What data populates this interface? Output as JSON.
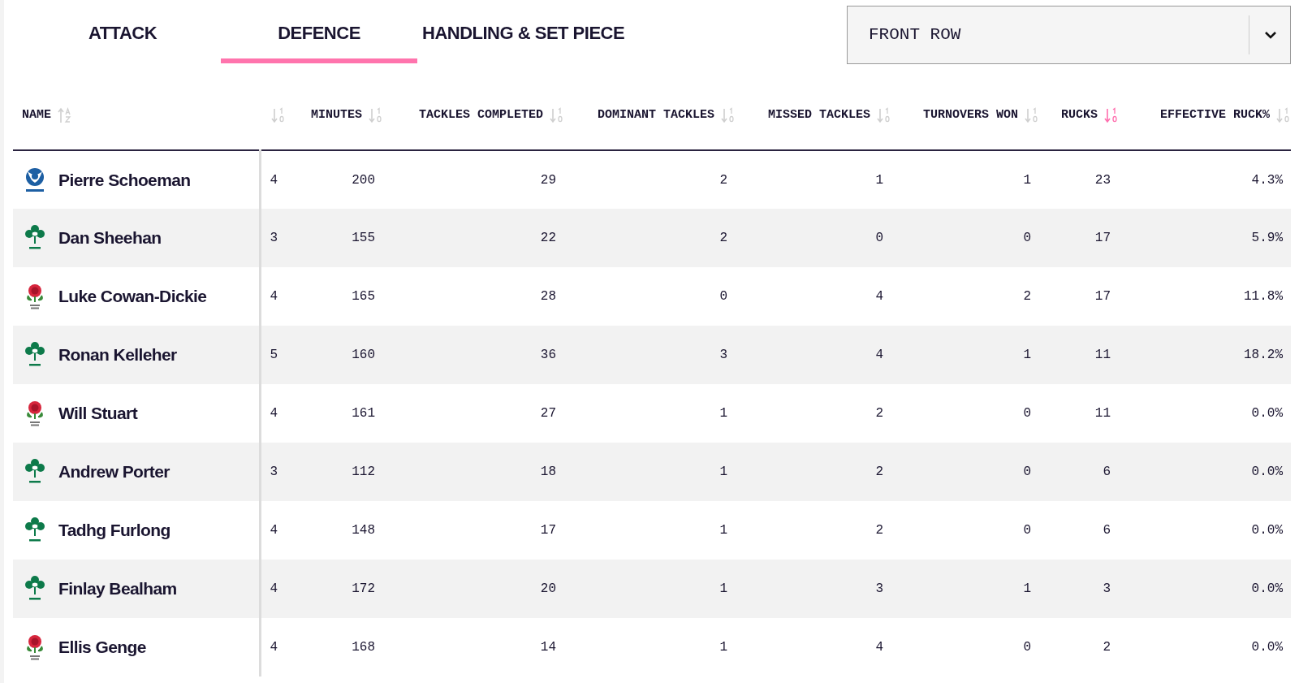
{
  "tabs": [
    {
      "label": "ATTACK",
      "selected": false
    },
    {
      "label": "DEFENCE",
      "selected": true
    },
    {
      "label": "HANDLING & SET PIECE",
      "selected": false
    }
  ],
  "position_filter": {
    "value": "FRONT ROW"
  },
  "table": {
    "columns": [
      {
        "label": "NAME",
        "kind": "alpha",
        "sorted": false
      },
      {
        "kind": "numeric",
        "sorted": false
      },
      {
        "label": "MINUTES",
        "kind": "numeric",
        "sorted": false
      },
      {
        "label": "TACKLES COMPLETED",
        "kind": "numeric",
        "sorted": false
      },
      {
        "label": "DOMINANT TACKLES",
        "kind": "numeric",
        "sorted": false
      },
      {
        "label": "MISSED TACKLES",
        "kind": "numeric",
        "sorted": false
      },
      {
        "label": "TURNOVERS WON",
        "kind": "numeric",
        "sorted": false
      },
      {
        "label": "RUCKS",
        "kind": "numeric",
        "sorted": true
      },
      {
        "label": "EFFECTIVE RUCK%",
        "kind": "numeric",
        "sorted": false
      }
    ],
    "rows": [
      {
        "kind": "scotland",
        "name": "Pierre Schoeman",
        "values": [
          "4",
          "200",
          "29",
          "2",
          "1",
          "1",
          "23",
          "4.3%"
        ]
      },
      {
        "kind": "ireland",
        "name": "Dan Sheehan",
        "values": [
          "3",
          "155",
          "22",
          "2",
          "0",
          "0",
          "17",
          "5.9%"
        ]
      },
      {
        "kind": "england",
        "name": "Luke Cowan-Dickie",
        "values": [
          "4",
          "165",
          "28",
          "0",
          "4",
          "2",
          "17",
          "11.8%"
        ]
      },
      {
        "kind": "ireland",
        "name": "Ronan Kelleher",
        "values": [
          "5",
          "160",
          "36",
          "3",
          "4",
          "1",
          "11",
          "18.2%"
        ]
      },
      {
        "kind": "england",
        "name": "Will Stuart",
        "values": [
          "4",
          "161",
          "27",
          "1",
          "2",
          "0",
          "11",
          "0.0%"
        ]
      },
      {
        "kind": "ireland",
        "name": "Andrew Porter",
        "values": [
          "3",
          "112",
          "18",
          "1",
          "2",
          "0",
          "6",
          "0.0%"
        ]
      },
      {
        "kind": "ireland",
        "name": "Tadhg Furlong",
        "values": [
          "4",
          "148",
          "17",
          "1",
          "2",
          "0",
          "6",
          "0.0%"
        ]
      },
      {
        "kind": "ireland",
        "name": "Finlay Bealham",
        "values": [
          "4",
          "172",
          "20",
          "1",
          "3",
          "1",
          "3",
          "0.0%"
        ]
      },
      {
        "kind": "england",
        "name": "Ellis Genge",
        "values": [
          "4",
          "168",
          "14",
          "1",
          "4",
          "0",
          "2",
          "0.0%"
        ]
      }
    ]
  }
}
